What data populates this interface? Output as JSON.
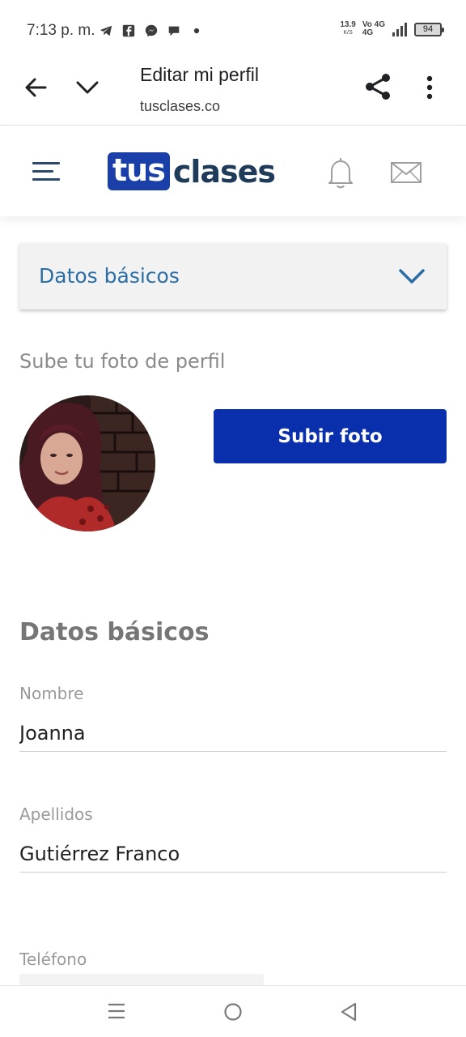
{
  "status_bar": {
    "time": "7:13 p. m.",
    "net_speed_value": "13.9",
    "net_speed_unit": "K/S",
    "volte_top": "Vo 4G",
    "volte_bottom": "4G",
    "battery": "94",
    "icons": [
      "telegram-icon",
      "facebook-icon",
      "messenger-icon",
      "chat-icon",
      "dot-icon",
      "signal-icon",
      "battery-icon"
    ]
  },
  "toolbar": {
    "title": "Editar mi perfil",
    "url": "tusclases.co"
  },
  "site_header": {
    "logo_box": "tus",
    "logo_text": "clases"
  },
  "accordion": {
    "label": "Datos básicos"
  },
  "photo": {
    "label": "Sube tu foto de perfil",
    "upload_button": "Subir foto"
  },
  "basic_data": {
    "title": "Datos básicos",
    "fields": [
      {
        "label": "Nombre",
        "value": "Joanna"
      },
      {
        "label": "Apellidos",
        "value": "Gutiérrez Franco"
      },
      {
        "label": "Teléfono",
        "value": ""
      }
    ]
  },
  "colors": {
    "brand_blue": "#0a2fac",
    "link_blue": "#2b6ea5",
    "logo_dark": "#1f3b5a"
  }
}
